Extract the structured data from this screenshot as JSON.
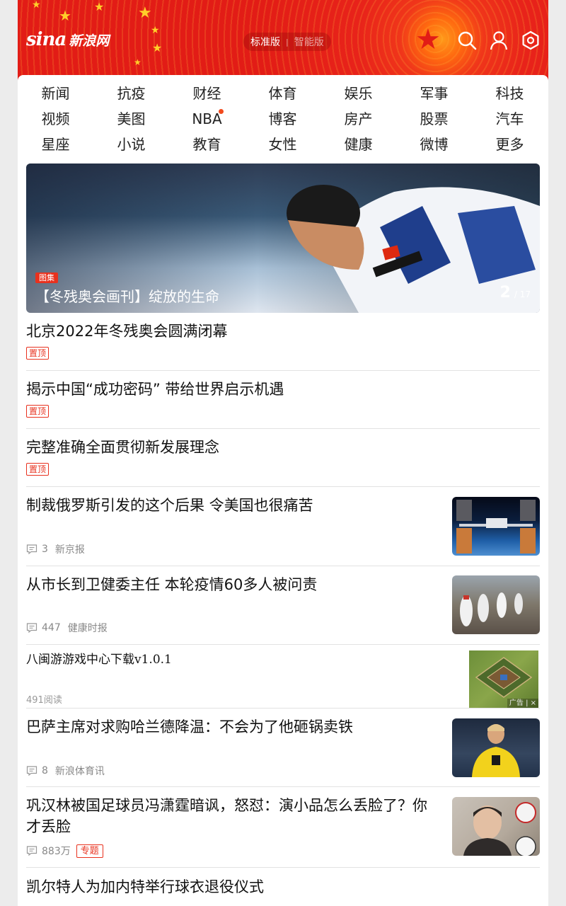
{
  "header": {
    "logo_latin": "sina",
    "logo_cn": "新浪网",
    "version_active": "标准版",
    "version_inactive": "智能版",
    "icons": [
      "search-icon",
      "user-icon",
      "settings-icon"
    ]
  },
  "nav": {
    "rows": [
      [
        "新闻",
        "抗疫",
        "财经",
        "体育",
        "娱乐",
        "军事",
        "科技"
      ],
      [
        "视频",
        "美图",
        "NBA",
        "博客",
        "房产",
        "股票",
        "汽车"
      ],
      [
        "星座",
        "小说",
        "教育",
        "女性",
        "健康",
        "微博",
        "更多"
      ]
    ]
  },
  "banner": {
    "tag": "图集",
    "caption": "【冬残奥会画刊】绽放的生命",
    "current": "2",
    "total": "/ 17"
  },
  "articles": [
    {
      "title": "北京2022年冬残奥会圆满闭幕",
      "pin": "置顶"
    },
    {
      "title": "揭示中国“成功密码” 带给世界启示机遇",
      "pin": "置顶"
    },
    {
      "title": "完整准确全面贯彻新发展理念",
      "pin": "置顶"
    },
    {
      "title": "制裁俄罗斯引发的这个后果 令美国也很痛苦",
      "comments": "3",
      "source": "新京报"
    },
    {
      "title": "从市长到卫健委主任 本轮疫情60多人被问责",
      "comments": "447",
      "source": "健康时报"
    },
    {
      "title": "八闽游游戏中心下载v1.0.1",
      "reads": "491阅读",
      "ad_label": "广告 | ×"
    },
    {
      "title": "巴萨主席对求购哈兰德降温：不会为了他砸锅卖铁",
      "comments": "8",
      "source": "新浪体育讯"
    },
    {
      "title_line1": "巩汉林被国足球员冯潇霆暗讽，怒怼：演小品怎么丢脸了？你",
      "title_line2": "才丢脸",
      "comments": "883万",
      "topic": "专题"
    },
    {
      "title": "凯尔特人为加内特举行球衣退役仪式"
    }
  ],
  "colors": {
    "brand_red": "#e21c16",
    "accent_orange": "#f24a1d",
    "tag_red": "#e8311e"
  }
}
